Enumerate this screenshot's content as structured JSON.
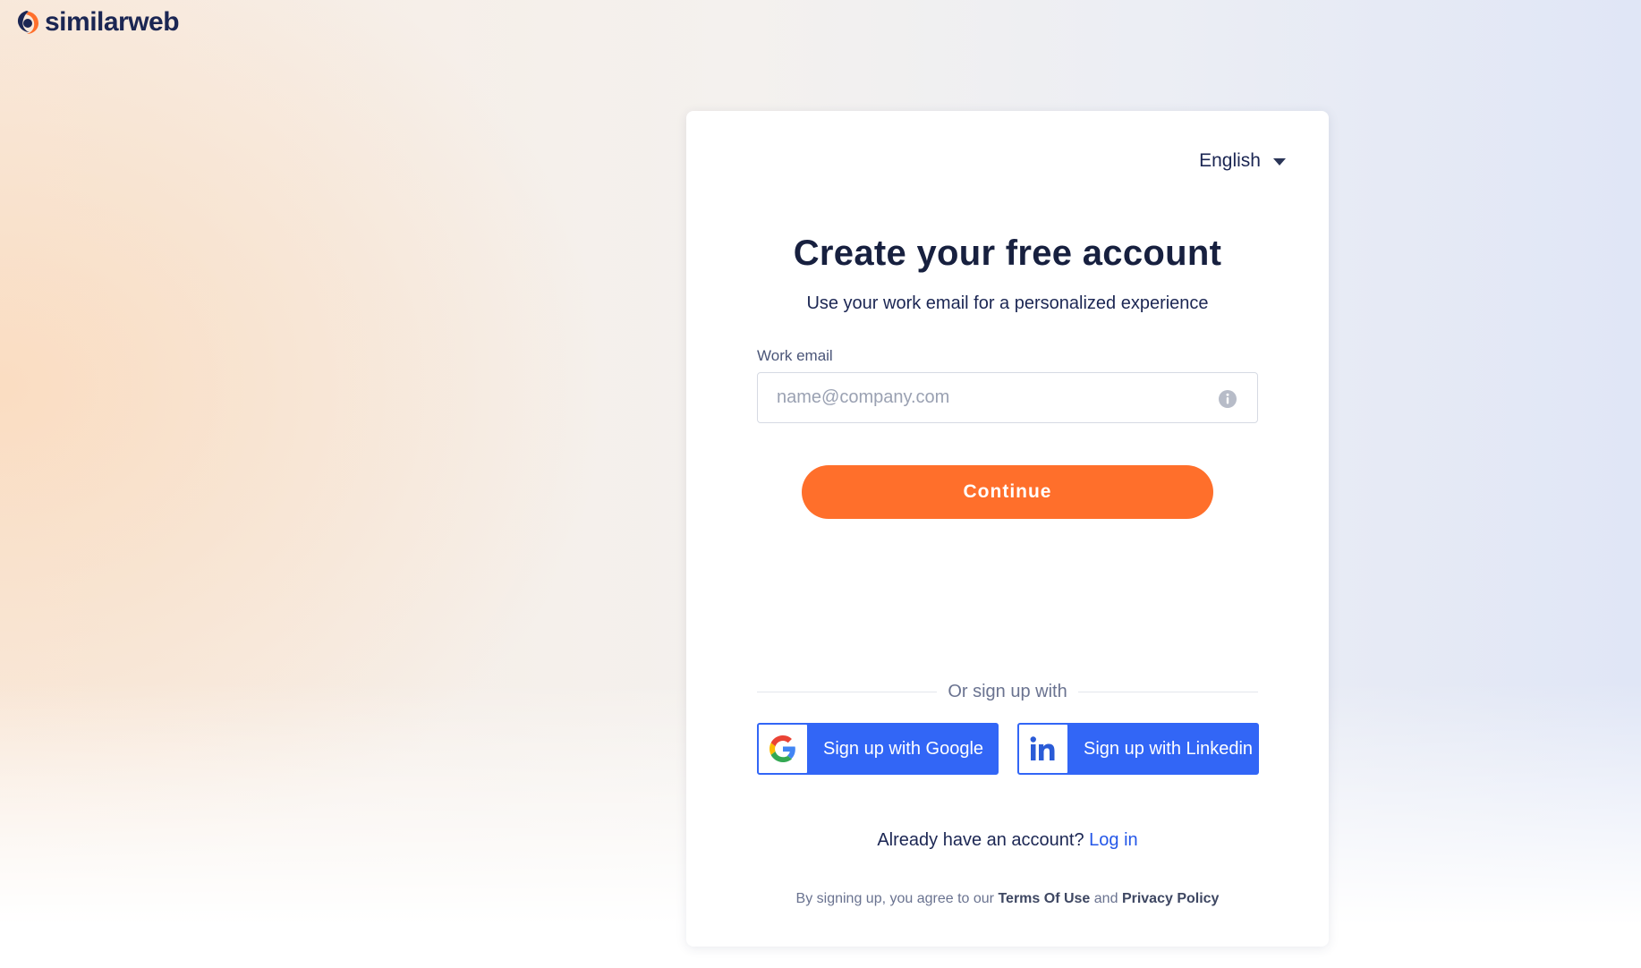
{
  "brand": {
    "name": "similarweb",
    "logo_icon": "similarweb-logo-icon"
  },
  "language": {
    "selected": "English",
    "icon": "chevron-down-icon"
  },
  "form": {
    "title": "Create your free account",
    "subtitle": "Use your work email for a personalized experience",
    "email_label": "Work email",
    "email_value": "",
    "email_placeholder": "name@company.com",
    "info_icon": "info-icon",
    "continue_label": "Continue",
    "continue_color": "#ff6f2b"
  },
  "social": {
    "divider_text": "Or sign up with",
    "button_color": "#3266f6",
    "google_label": "Sign up with Google",
    "linkedin_label": "Sign up with Linkedin"
  },
  "login": {
    "prompt": "Already have an account?",
    "link": "Log in"
  },
  "terms": {
    "prefix": "By signing up, you agree to our",
    "terms_link": "Terms Of Use",
    "conjunction": "and",
    "privacy_link": "Privacy Policy"
  }
}
